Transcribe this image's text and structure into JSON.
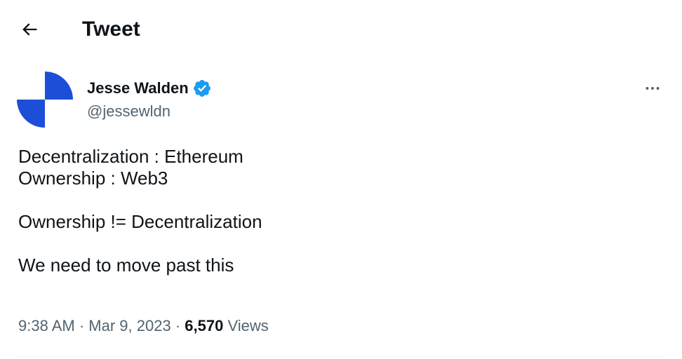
{
  "header": {
    "title": "Tweet",
    "back_icon": "arrow-left-icon"
  },
  "author": {
    "name": "Jesse Walden",
    "handle": "@jessewldn",
    "verified_icon": "verified-badge-icon",
    "avatar_colors": [
      "#1d4ed8",
      "#ffffff"
    ]
  },
  "more_icon": "more-horizontal-icon",
  "tweet": {
    "lines": [
      "Decentralization : Ethereum",
      "Ownership : Web3",
      "",
      "Ownership != Decentralization",
      "",
      "We need to move past this"
    ]
  },
  "meta": {
    "time": "9:38 AM",
    "separator": "·",
    "date": "Mar 9, 2023",
    "views_count": "6,570",
    "views_label": "Views"
  },
  "colors": {
    "text_primary": "#0f1419",
    "text_secondary": "#536471",
    "verified_blue": "#1d9bf0",
    "divider": "#eff3f4"
  }
}
